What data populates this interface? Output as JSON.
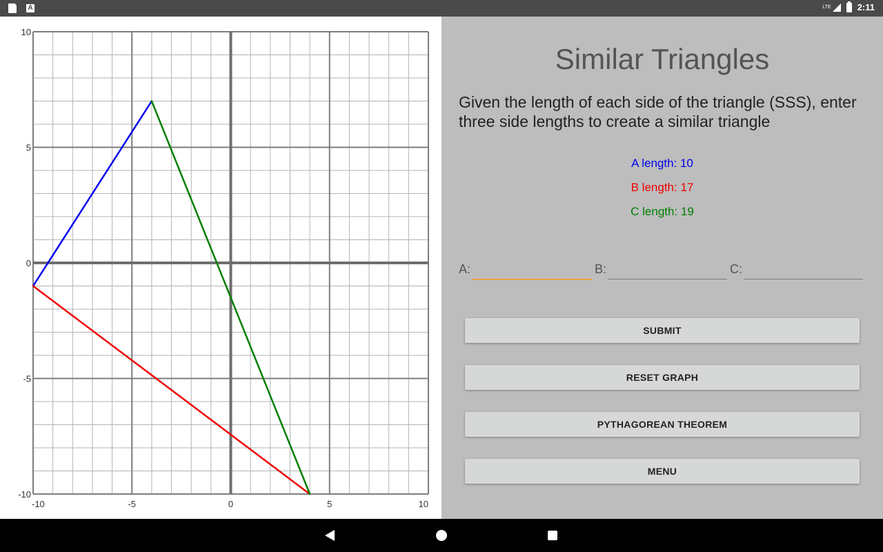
{
  "status_bar": {
    "time": "2:11",
    "network": "LTE"
  },
  "graph": {
    "x_ticks": [
      "-10",
      "-5",
      "0",
      "5",
      "10"
    ],
    "y_ticks": [
      "10",
      "5",
      "0",
      "-5",
      "-10"
    ],
    "xlim": [
      -10,
      10
    ],
    "ylim": [
      -10,
      10
    ],
    "triangle": {
      "vertices": {
        "P": [
          -10,
          -1
        ],
        "Q": [
          -4,
          7
        ],
        "R": [
          4,
          -10
        ]
      },
      "sides": [
        {
          "name": "A",
          "from": "P",
          "to": "Q",
          "color": "#0000ee"
        },
        {
          "name": "B",
          "from": "P",
          "to": "R",
          "color": "#ee0000"
        },
        {
          "name": "C",
          "from": "Q",
          "to": "R",
          "color": "#007f00"
        }
      ]
    }
  },
  "title": "Similar Triangles",
  "instructions": "Given the length of each side of the triangle (SSS), enter three side lengths to create a similar triangle",
  "lengths": {
    "a": "A length: 10",
    "b": "B length: 17",
    "c": "C length: 19"
  },
  "inputs": {
    "a_label": "A:",
    "a_value": "",
    "b_label": "B:",
    "b_value": "",
    "c_label": "C:",
    "c_value": ""
  },
  "buttons": {
    "submit": "SUBMIT",
    "reset": "RESET GRAPH",
    "pythagorean": "PYTHAGOREAN THEOREM",
    "menu": "MENU"
  },
  "colors": {
    "side_a": "#0000ee",
    "side_b": "#ee0000",
    "side_c": "#007f00",
    "focus_underline": "#f0a13a",
    "panel_background": "#bdbdbd"
  }
}
